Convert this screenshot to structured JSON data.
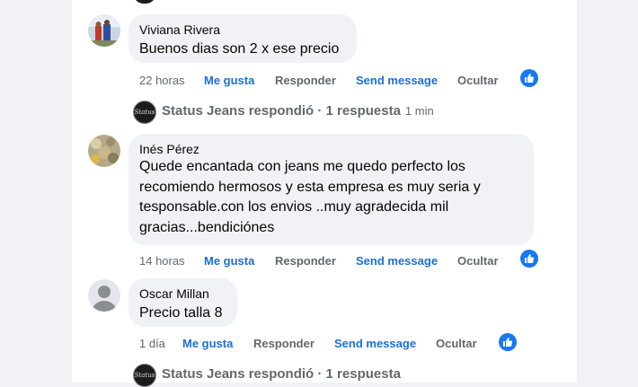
{
  "comments": [
    {
      "author": "Viviana Rivera",
      "text": "Buenos dias son 2 x ese precio",
      "time": "22 horas",
      "like": "Me gusta",
      "reply": "Responder",
      "send": "Send message",
      "hide": "Ocultar"
    },
    {
      "author": "Inés Pérez",
      "text": "Quede encantada con jeans me quedo perfecto los\nrecomiendo hermosos y esta empresa es muy seria y\ntesponsable.con los envios ..muy agradecida mil\ngracias...bendiciónes",
      "time": "14 horas",
      "like": "Me gusta",
      "reply": "Responder",
      "send": "Send message",
      "hide": "Ocultar"
    },
    {
      "author": "Oscar Millan",
      "text": "Precio talla 8",
      "time": "1 día",
      "like": "Me gusta",
      "reply": "Responder",
      "send": "Send message",
      "hide": "Ocultar"
    }
  ],
  "replies": [
    {
      "label": "Status Jeans respondió · 1 respuesta",
      "time": "1 min",
      "avatar_text": "Status"
    },
    {
      "label": "Status Jeans respondió · 1 respuesta",
      "time": "",
      "avatar_text": "Status"
    }
  ],
  "colors": {
    "link_blue": "#1b6fd6",
    "like_blue": "#1877f2",
    "muted": "#65676b",
    "bubble": "#f0f2f5"
  },
  "icons": {
    "reaction": "thumbs-up-icon",
    "profile_default": "default-avatar-icon"
  }
}
